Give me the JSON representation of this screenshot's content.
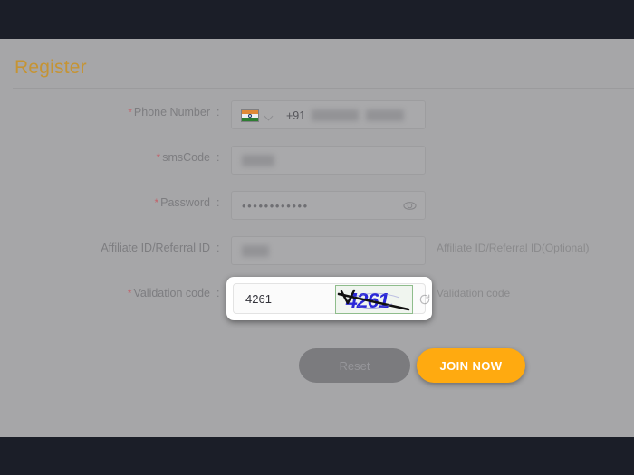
{
  "page": {
    "title": "Register",
    "required_marker": "*",
    "colon": ":"
  },
  "form": {
    "fields": [
      {
        "name": "phone",
        "label": "Phone Number",
        "required": true,
        "country_flag": "india-flag-icon",
        "dial_code": "+91",
        "value_redacted": true,
        "helper": ""
      },
      {
        "name": "sms_code",
        "label": "smsCode",
        "required": true,
        "value_redacted": true,
        "helper": ""
      },
      {
        "name": "password",
        "label": "Password",
        "required": true,
        "value_masked": "••••••••••••",
        "toggle_icon": "eye-icon",
        "helper": ""
      },
      {
        "name": "affiliate_id",
        "label": "Affiliate ID/Referral ID",
        "required": false,
        "value_redacted": true,
        "helper": "Affiliate ID/Referral ID(Optional)"
      },
      {
        "name": "validation_code",
        "label": "Validation code",
        "required": true,
        "value": "4261",
        "captcha_text": "4261",
        "refresh_icon": "refresh-icon",
        "helper": "Validation code",
        "focused": true
      }
    ]
  },
  "buttons": {
    "reset": "Reset",
    "join": "JOIN NOW"
  },
  "colors": {
    "brand_amber": "#c59434",
    "join_button": "#ffaa10",
    "reset_button": "#7b7b7e",
    "required_asterisk": "#c2626a",
    "captcha_text": "#2a28d8",
    "chrome_dark": "#1b1e28",
    "overlay_scrim": "#a6a6a8"
  }
}
